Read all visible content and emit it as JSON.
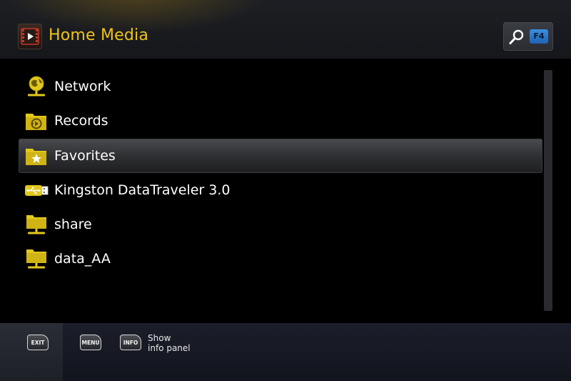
{
  "header": {
    "title": "Home Media",
    "app_icon": "video-film-icon",
    "search_icon": "magnifier-icon",
    "search_key": "F4",
    "accent_color": "#f0c419"
  },
  "list": {
    "items": [
      {
        "label": "Network",
        "icon": "network-globe-icon"
      },
      {
        "label": "Records",
        "icon": "records-folder-icon"
      },
      {
        "label": "Favorites",
        "icon": "favorites-star-folder-icon",
        "selected": true
      },
      {
        "label": "Kingston DataTraveler 3.0",
        "icon": "usb-drive-icon"
      },
      {
        "label": "share",
        "icon": "network-folder-icon"
      },
      {
        "label": "data_AA",
        "icon": "network-folder-icon"
      }
    ]
  },
  "footer": {
    "exit_key": "EXIT",
    "menu_key": "MENU",
    "info_key": "INFO",
    "info_text_line1": "Show",
    "info_text_line2": "info panel"
  }
}
